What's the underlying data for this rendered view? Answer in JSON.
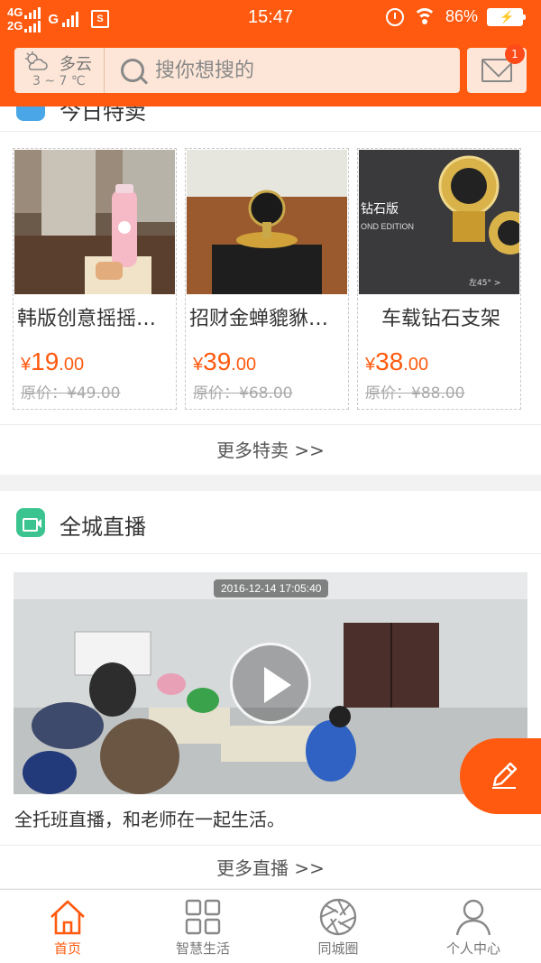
{
  "status_bar": {
    "net_top": "4G",
    "net_bottom": "2G",
    "net_g": "G",
    "sim_label": "S",
    "time": "15:47",
    "battery": "86%"
  },
  "header": {
    "weather": {
      "condition": "多云",
      "temp": "3 ~ 7 ℃",
      "icon": "partly-cloudy-icon"
    },
    "search_placeholder": "搜你想搜的",
    "message_badge": "1",
    "colors": {
      "brand": "#ff5a0f",
      "search_bg": "#fde6d7"
    }
  },
  "sale": {
    "title": "今日特卖",
    "products": [
      {
        "name": "韩版创意摇摇杯保温杯",
        "price_int": "19",
        "price_dec": ".00",
        "currency": "¥",
        "original": "原价：¥49.00"
      },
      {
        "name": "招财金蝉貔貅车载摆件",
        "price_int": "39",
        "price_dec": ".00",
        "currency": "¥",
        "original": "原价：¥68.00"
      },
      {
        "name": "车载钻石支架",
        "price_int": "38",
        "price_dec": ".00",
        "currency": "¥",
        "original": "原价：¥88.00"
      }
    ],
    "product_image_text": {
      "badge": "钻石版",
      "edition": "OND EDITION",
      "angle": "左45° >"
    },
    "more": "更多特卖 >>"
  },
  "live": {
    "title": "全城直播",
    "timestamp": "2016-12-14 17:05:40",
    "description": "全托班直播，和老师在一起生活。",
    "more": "更多直播 >>"
  },
  "tabbar": {
    "tabs": [
      {
        "label": "首页",
        "icon": "home-icon",
        "active": true
      },
      {
        "label": "智慧生活",
        "icon": "grid-icon",
        "active": false
      },
      {
        "label": "同城圈",
        "icon": "aperture-icon",
        "active": false
      },
      {
        "label": "个人中心",
        "icon": "user-icon",
        "active": false
      }
    ]
  }
}
